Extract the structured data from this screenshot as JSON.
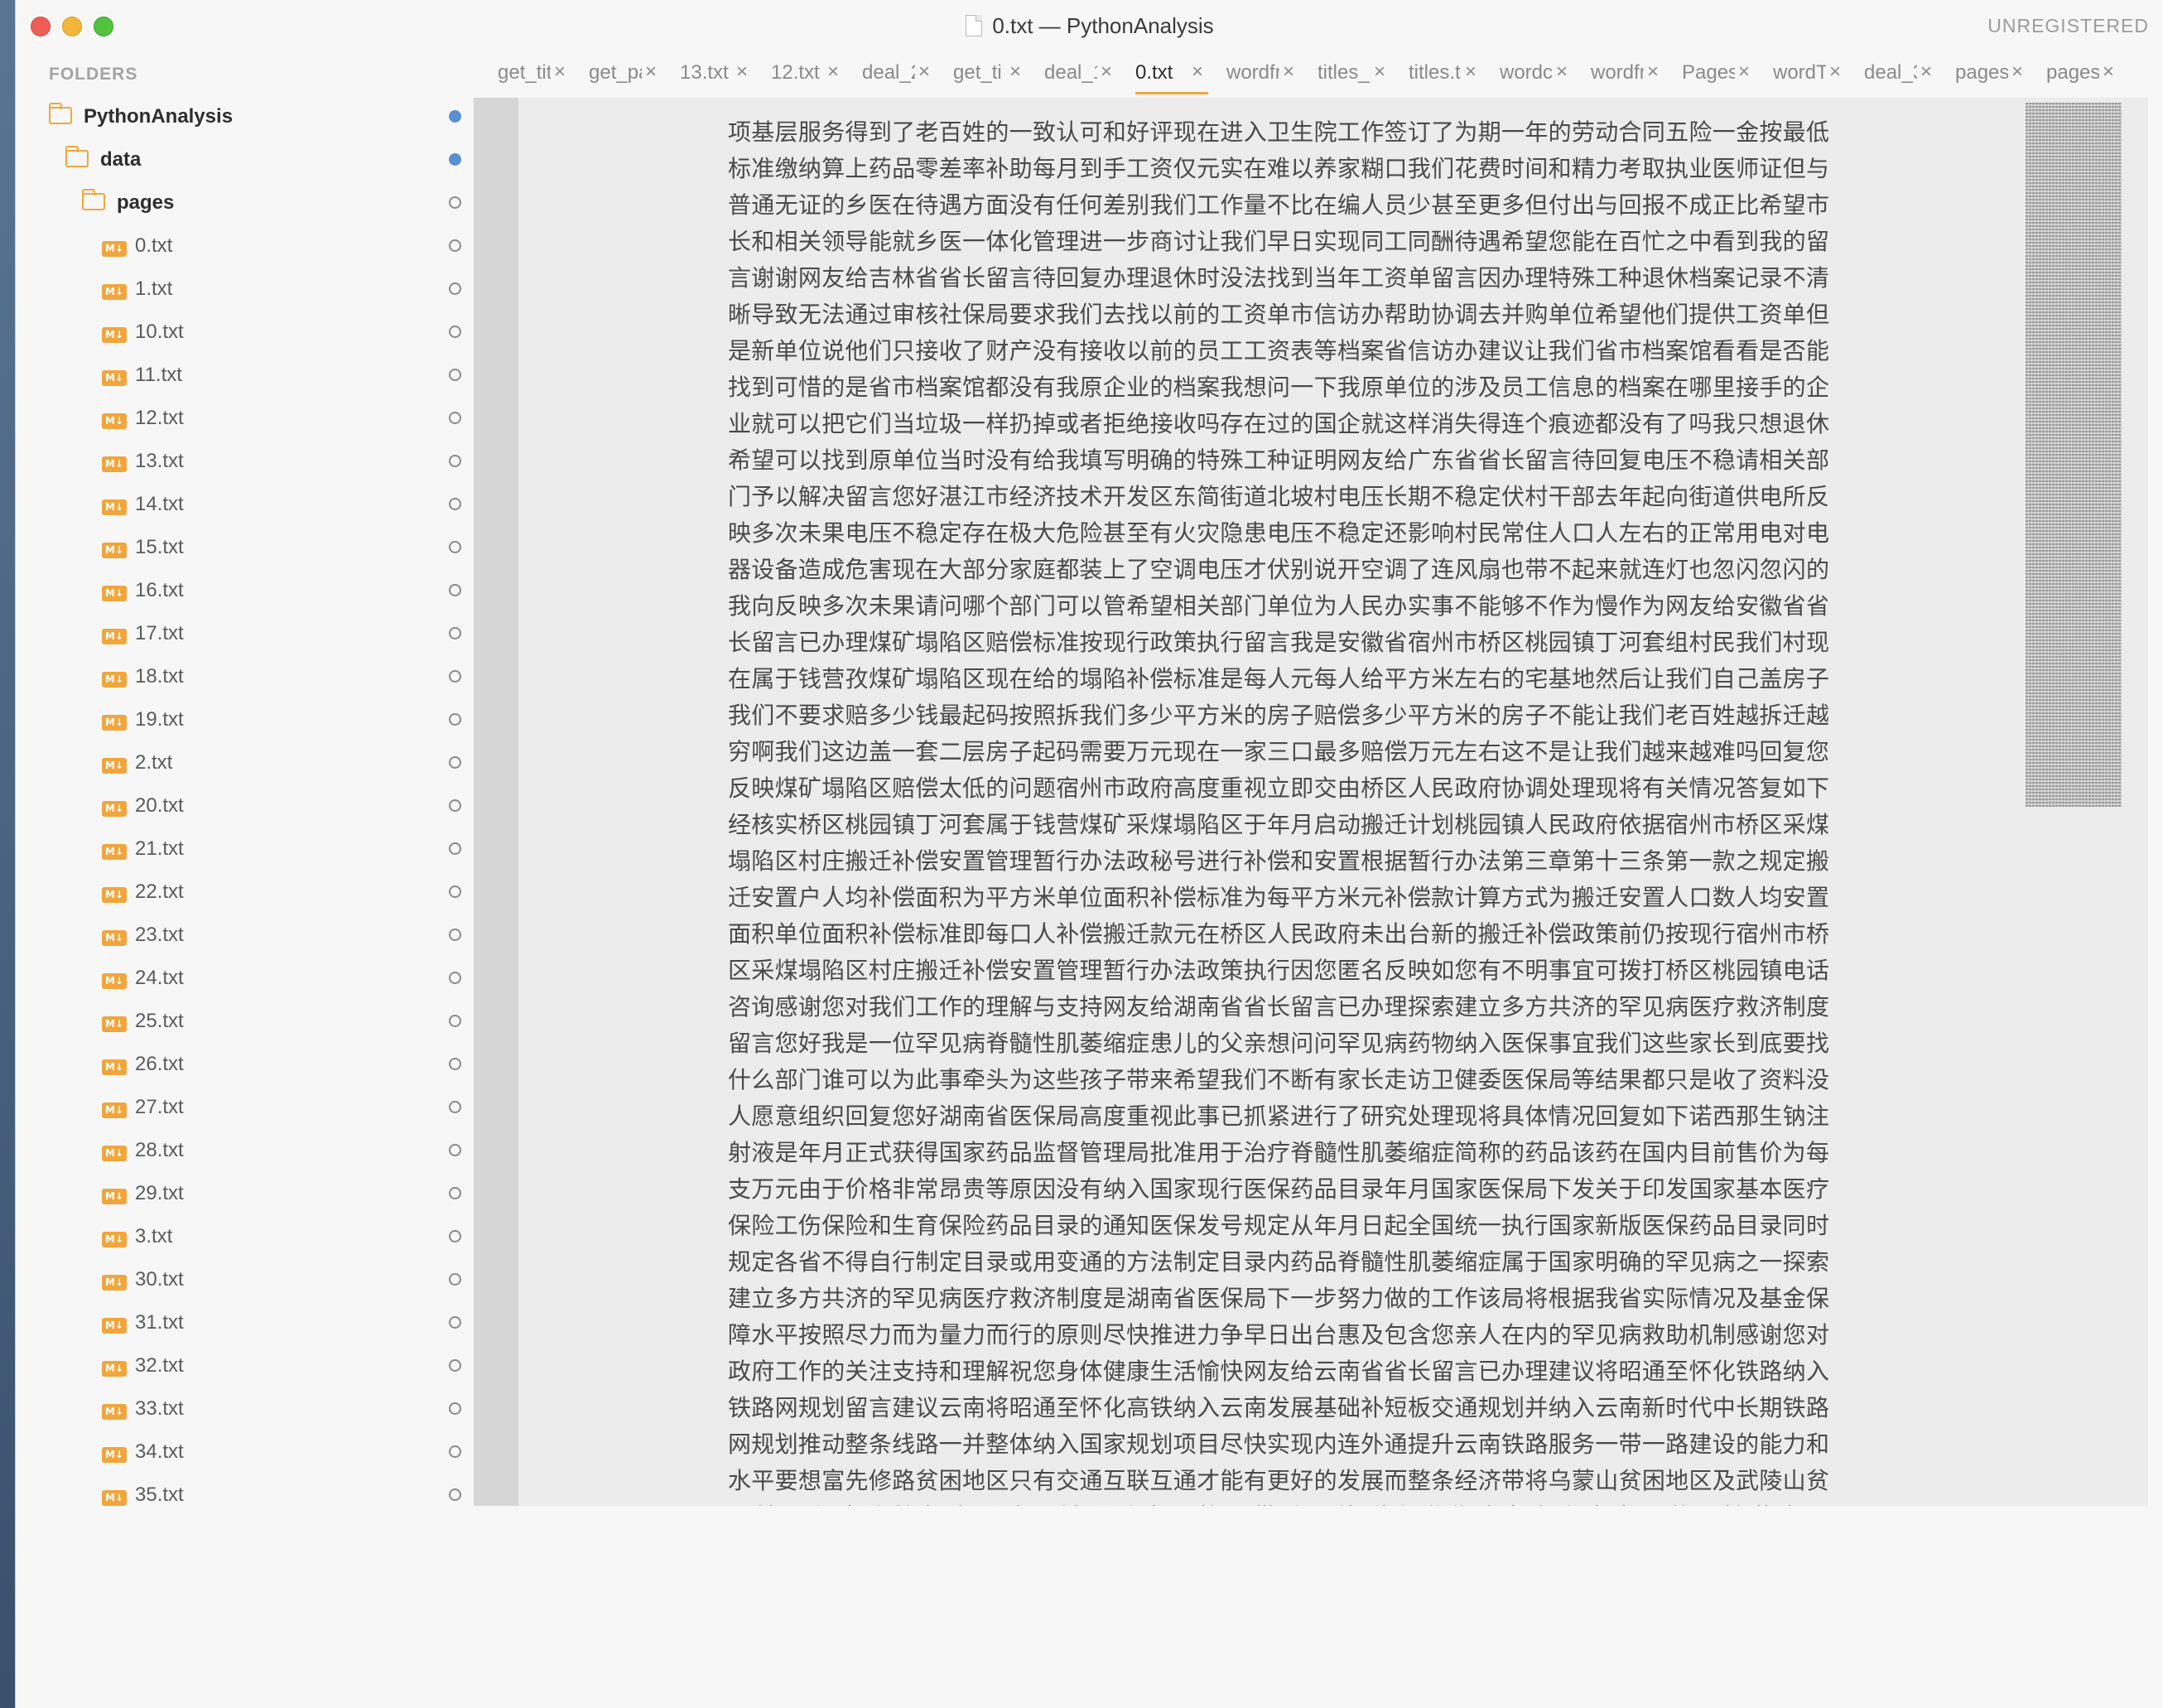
{
  "window": {
    "title": "0.txt — PythonAnalysis",
    "license_status": "UNREGISTERED"
  },
  "sidebar": {
    "header": "FOLDERS",
    "folders": [
      {
        "name": "PythonAnalysis",
        "modified": true
      },
      {
        "name": "data",
        "modified": true
      },
      {
        "name": "pages",
        "modified": false
      }
    ],
    "file_icon_label": "M↓",
    "files": [
      "0.txt",
      "1.txt",
      "10.txt",
      "11.txt",
      "12.txt",
      "13.txt",
      "14.txt",
      "15.txt",
      "16.txt",
      "17.txt",
      "18.txt",
      "19.txt",
      "2.txt",
      "20.txt",
      "21.txt",
      "22.txt",
      "23.txt",
      "24.txt",
      "25.txt",
      "26.txt",
      "27.txt",
      "28.txt",
      "29.txt",
      "3.txt",
      "30.txt",
      "31.txt",
      "32.txt",
      "33.txt",
      "34.txt",
      "35.txt"
    ]
  },
  "tabs": {
    "close_glyph": "×",
    "active_index": 7,
    "items": [
      "get_tit",
      "get_pa",
      "13.txt",
      "12.txt",
      "deal_2",
      "get_ti",
      "deal_1",
      "0.txt",
      "wordfr",
      "titles_",
      "titles.t",
      "wordc",
      "wordfr",
      "Pages",
      "wordT",
      "deal_3",
      "pages",
      "pages"
    ]
  },
  "editor": {
    "lines": [
      "项基层服务得到了老百姓的一致认可和好评现在进入卫生院工作签订了为期一年的劳动合同五险一金按最低",
      "标准缴纳算上药品零差率补助每月到手工资仅元实在难以养家糊口我们花费时间和精力考取执业医师证但与",
      "普通无证的乡医在待遇方面没有任何差别我们工作量不比在编人员少甚至更多但付出与回报不成正比希望市",
      "长和相关领导能就乡医一体化管理进一步商讨让我们早日实现同工同酬待遇希望您能在百忙之中看到我的留",
      "言谢谢网友给吉林省省长留言待回复办理退休时没法找到当年工资单留言因办理特殊工种退休档案记录不清",
      "晰导致无法通过审核社保局要求我们去找以前的工资单市信访办帮助协调去并购单位希望他们提供工资单但",
      "是新单位说他们只接收了财产没有接收以前的员工工资表等档案省信访办建议让我们省市档案馆看看是否能",
      "找到可惜的是省市档案馆都没有我原企业的档案我想问一下我原单位的涉及员工信息的档案在哪里接手的企",
      "业就可以把它们当垃圾一样扔掉或者拒绝接收吗存在过的国企就这样消失得连个痕迹都没有了吗我只想退休",
      "希望可以找到原单位当时没有给我填写明确的特殊工种证明网友给广东省省长留言待回复电压不稳请相关部",
      "门予以解决留言您好湛江市经济技术开发区东简街道北坡村电压长期不稳定伏村干部去年起向街道供电所反",
      "映多次未果电压不稳定存在极大危险甚至有火灾隐患电压不稳定还影响村民常住人口人左右的正常用电对电",
      "器设备造成危害现在大部分家庭都装上了空调电压才伏别说开空调了连风扇也带不起来就连灯也忽闪忽闪的",
      "我向反映多次未果请问哪个部门可以管希望相关部门单位为人民办实事不能够不作为慢作为网友给安徽省省",
      "长留言已办理煤矿塌陷区赔偿标准按现行政策执行留言我是安徽省宿州市桥区桃园镇丁河套组村民我们村现",
      "在属于钱营孜煤矿塌陷区现在给的塌陷补偿标准是每人元每人给平方米左右的宅基地然后让我们自己盖房子",
      "我们不要求赔多少钱最起码按照拆我们多少平方米的房子赔偿多少平方米的房子不能让我们老百姓越拆迁越",
      "穷啊我们这边盖一套二层房子起码需要万元现在一家三口最多赔偿万元左右这不是让我们越来越难吗回复您",
      "反映煤矿塌陷区赔偿太低的问题宿州市政府高度重视立即交由桥区人民政府协调处理现将有关情况答复如下",
      "经核实桥区桃园镇丁河套属于钱营煤矿采煤塌陷区于年月启动搬迁计划桃园镇人民政府依据宿州市桥区采煤",
      "塌陷区村庄搬迁补偿安置管理暂行办法政秘号进行补偿和安置根据暂行办法第三章第十三条第一款之规定搬",
      "迁安置户人均补偿面积为平方米单位面积补偿标准为每平方米元补偿款计算方式为搬迁安置人口数人均安置",
      "面积单位面积补偿标准即每口人补偿搬迁款元在桥区人民政府未出台新的搬迁补偿政策前仍按现行宿州市桥",
      "区采煤塌陷区村庄搬迁补偿安置管理暂行办法政策执行因您匿名反映如您有不明事宜可拨打桥区桃园镇电话",
      "咨询感谢您对我们工作的理解与支持网友给湖南省省长留言已办理探索建立多方共济的罕见病医疗救济制度",
      "留言您好我是一位罕见病脊髓性肌萎缩症患儿的父亲想问问罕见病药物纳入医保事宜我们这些家长到底要找",
      "什么部门谁可以为此事牵头为这些孩子带来希望我们不断有家长走访卫健委医保局等结果都只是收了资料没",
      "人愿意组织回复您好湖南省医保局高度重视此事已抓紧进行了研究处理现将具体情况回复如下诺西那生钠注",
      "射液是年月正式获得国家药品监督管理局批准用于治疗脊髓性肌萎缩症简称的药品该药在国内目前售价为每",
      "支万元由于价格非常昂贵等原因没有纳入国家现行医保药品目录年月国家医保局下发关于印发国家基本医疗",
      "保险工伤保险和生育保险药品目录的通知医保发号规定从年月日起全国统一执行国家新版医保药品目录同时",
      "规定各省不得自行制定目录或用变通的方法制定目录内药品脊髓性肌萎缩症属于国家明确的罕见病之一探索",
      "建立多方共济的罕见病医疗救济制度是湖南省医保局下一步努力做的工作该局将根据我省实际情况及基金保",
      "障水平按照尽力而为量力而行的原则尽快推进力争早日出台惠及包含您亲人在内的罕见病救助机制感谢您对",
      "政府工作的关注支持和理解祝您身体健康生活愉快网友给云南省省长留言已办理建议将昭通至怀化铁路纳入",
      "铁路网规划留言建议云南将昭通至怀化高铁纳入云南发展基础补短板交通规划并纳入云南新时代中长期铁路",
      "网规划推动整条线路一并整体纳入国家规划项目尽快实现内连外通提升云南铁路服务一带一路建设的能力和",
      "水平要想富先修路贫困地区只有交通互联互通才能有更好的发展而整条经济带将乌蒙山贫困地区及武陵山贫",
      "困地区紧密连接起来形成区域联动发展格局带动沿线群众脱贫致富奔小康实现共同繁荣发展"
    ]
  }
}
